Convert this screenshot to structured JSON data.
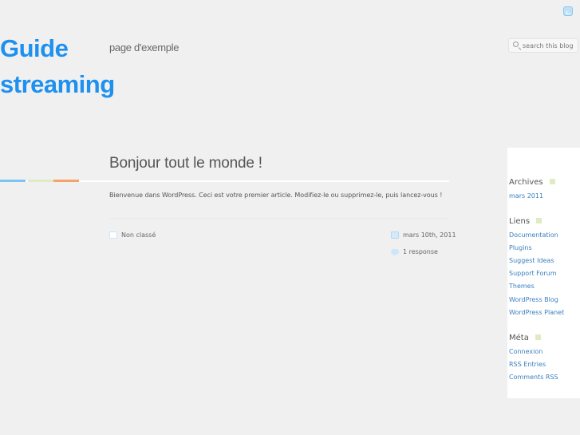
{
  "header": {
    "title_line1": "Guide",
    "title_line2": "streaming",
    "tagline": "page d'exemple"
  },
  "search": {
    "placeholder": "search this blog",
    "icon": "search-icon"
  },
  "colors": {
    "accent": "#1e90f0",
    "bar1": "#7cc4f2",
    "bar2": "#dcecc6",
    "bar3": "#f4a36d"
  },
  "post": {
    "title": "Bonjour tout le monde !",
    "body": "Bienvenue dans WordPress. Ceci est votre premier article. Modifiez-le ou supprimez-le, puis lancez-vous !",
    "category": "Non classé",
    "date": "mars 10th, 2011",
    "responses": "1 response"
  },
  "sidebar": {
    "archives": {
      "title": "Archives",
      "items": [
        "mars 2011"
      ]
    },
    "liens": {
      "title": "Liens",
      "items": [
        "Documentation",
        "Plugins",
        "Suggest Ideas",
        "Support Forum",
        "Themes",
        "WordPress Blog",
        "WordPress Planet"
      ]
    },
    "meta": {
      "title": "Méta",
      "items": [
        "Connexion",
        "RSS Entries",
        "Comments RSS"
      ]
    }
  }
}
